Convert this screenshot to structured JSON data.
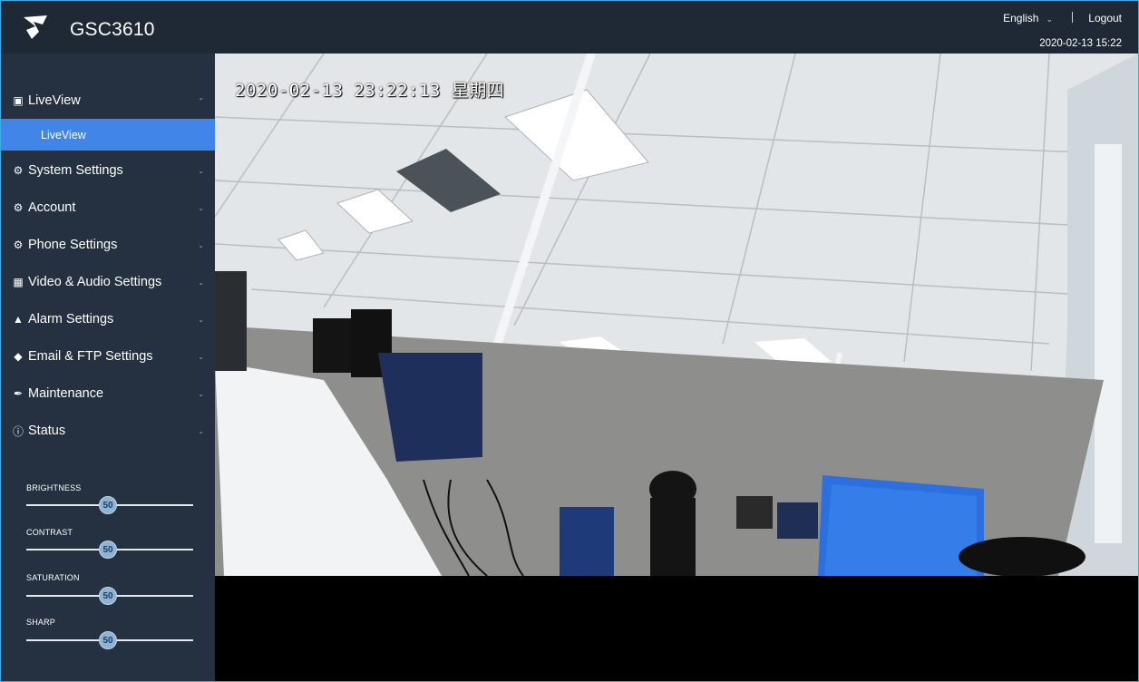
{
  "header": {
    "product": "GSC3610",
    "language": "English",
    "logout": "Logout",
    "datetime": "2020-02-13 15:22"
  },
  "sidebar": {
    "items": [
      {
        "label": "LiveView",
        "icon": "video-icon",
        "expanded": true
      },
      {
        "label": "System Settings",
        "icon": "gear-icon"
      },
      {
        "label": "Account",
        "icon": "gear-icon"
      },
      {
        "label": "Phone Settings",
        "icon": "gear-icon"
      },
      {
        "label": "Video & Audio Settings",
        "icon": "camera-icon"
      },
      {
        "label": "Alarm Settings",
        "icon": "alarm-icon"
      },
      {
        "label": "Email & FTP Settings",
        "icon": "email-icon"
      },
      {
        "label": "Maintenance",
        "icon": "wrench-icon"
      },
      {
        "label": "Status",
        "icon": "info-icon"
      }
    ],
    "subitem": "LiveView"
  },
  "image_controls": [
    {
      "label": "BRIGHTNESS",
      "value": "50"
    },
    {
      "label": "CONTRAST",
      "value": "50"
    },
    {
      "label": "SATURATION",
      "value": "50"
    },
    {
      "label": "SHARP",
      "value": "50"
    }
  ],
  "video": {
    "osd_text": "2020-02-13 23:22:13 星期四"
  },
  "colors": {
    "accent": "#4285e8",
    "sidebar_bg": "#253140",
    "frame_border": "#3fa9e6"
  }
}
